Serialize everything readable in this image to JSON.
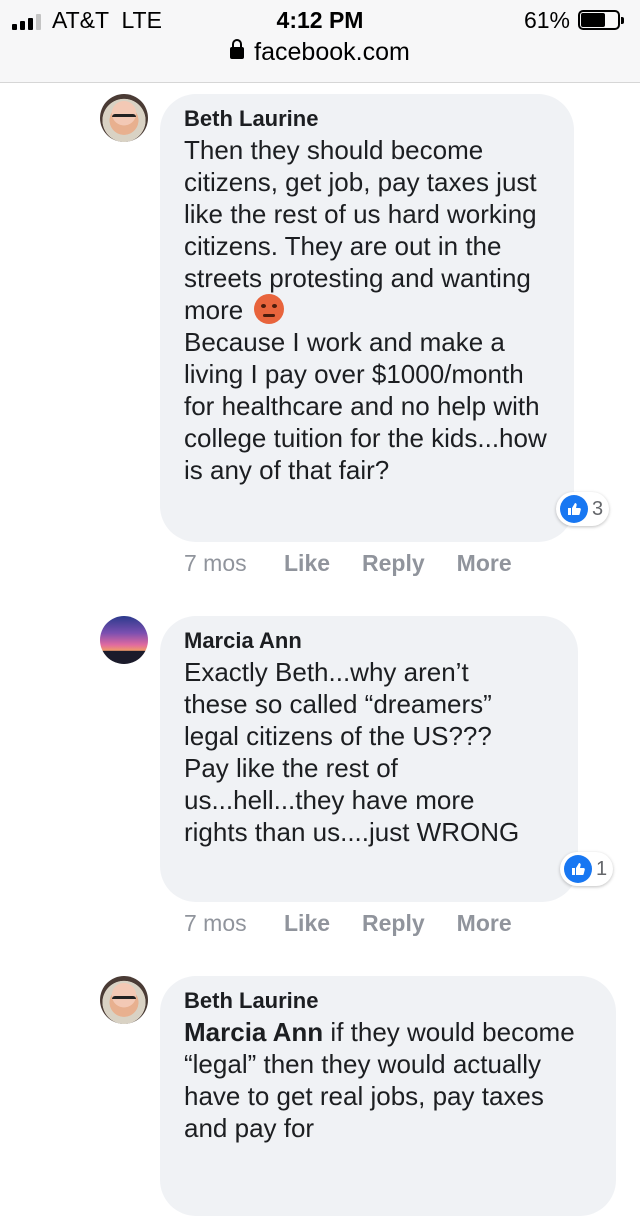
{
  "status_bar": {
    "carrier": "AT&T  LTE",
    "time": "4:12 PM",
    "battery": "61%"
  },
  "url": "facebook.com",
  "comments": [
    {
      "author": "Beth Laurine",
      "text_part1": "Then they should become citizens, get job, pay taxes just like the rest of us hard working citizens. They are out in the streets protesting and wanting more",
      "emoji": "angry-face-emoji",
      "text_part2": "Because I work and make a living I pay over $1000/month for healthcare and no help with college tuition for the kids...how is any of that fair?",
      "reaction_count": "3",
      "time_ago": "7 mos",
      "like_label": "Like",
      "reply_label": "Reply",
      "more_label": "More"
    },
    {
      "author": "Marcia Ann",
      "text": "Exactly Beth...why aren’t these so called “dreamers” legal citizens of the US??? Pay like the rest of us...hell...they have more rights than us....just WRONG",
      "reaction_count": "1",
      "time_ago": "7 mos",
      "like_label": "Like",
      "reply_label": "Reply",
      "more_label": "More"
    },
    {
      "author": "Beth Laurine",
      "mention": "Marcia Ann",
      "text": " if they would become “legal” then they would actually have to get real jobs, pay taxes and pay for"
    }
  ]
}
